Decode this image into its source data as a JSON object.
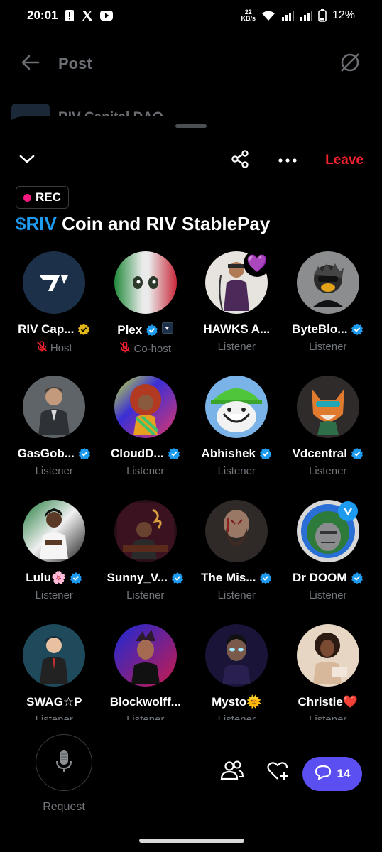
{
  "status_bar": {
    "time": "20:01",
    "net_speed_value": "22",
    "net_speed_unit": "KB/s",
    "battery": "12%"
  },
  "background_post": {
    "title": "Post",
    "author": "RIV Capital DAO"
  },
  "space": {
    "rec_label": "REC",
    "title_highlight": "$RIV",
    "title_rest": " Coin and RIV StablePay",
    "leave_label": "Leave"
  },
  "participants": [
    {
      "name": "RIV Cap...",
      "role": "Host",
      "muted": true,
      "verified": "gold"
    },
    {
      "name": "Plex",
      "role": "Co-host",
      "muted": true,
      "verified": "blue"
    },
    {
      "name": "HAWKS A...",
      "role": "Listener",
      "emoji": "💜"
    },
    {
      "name": "ByteBlo...",
      "role": "Listener",
      "verified": "blue"
    },
    {
      "name": "GasGob...",
      "role": "Listener",
      "verified": "blue"
    },
    {
      "name": "CloudD...",
      "role": "Listener",
      "verified": "blue"
    },
    {
      "name": "Abhishek",
      "role": "Listener",
      "verified": "blue"
    },
    {
      "name": "Vdcentral",
      "role": "Listener",
      "verified": "blue"
    },
    {
      "name": "Lulu🌸",
      "role": "Listener",
      "verified": "blue"
    },
    {
      "name": "Sunny_V...",
      "role": "Listener",
      "verified": "blue"
    },
    {
      "name": "The Mis...",
      "role": "Listener",
      "verified": "blue"
    },
    {
      "name": "Dr DOOM",
      "role": "Listener",
      "verified": "blue"
    },
    {
      "name": "SWAG☆P",
      "role": "Listener"
    },
    {
      "name": "Blockwolff...",
      "role": "Listener"
    },
    {
      "name": "Mysto🌞",
      "role": "Listener"
    },
    {
      "name": "Christie❤️",
      "role": "Listener"
    }
  ],
  "bottom_bar": {
    "request_label": "Request",
    "chat_count": "14"
  },
  "colors": {
    "accent_blue": "#1d9bf0",
    "leave_red": "#f4212e",
    "rec_pink": "#f91880",
    "chat_purple": "#5b4ff1",
    "gold": "#e2b719"
  }
}
